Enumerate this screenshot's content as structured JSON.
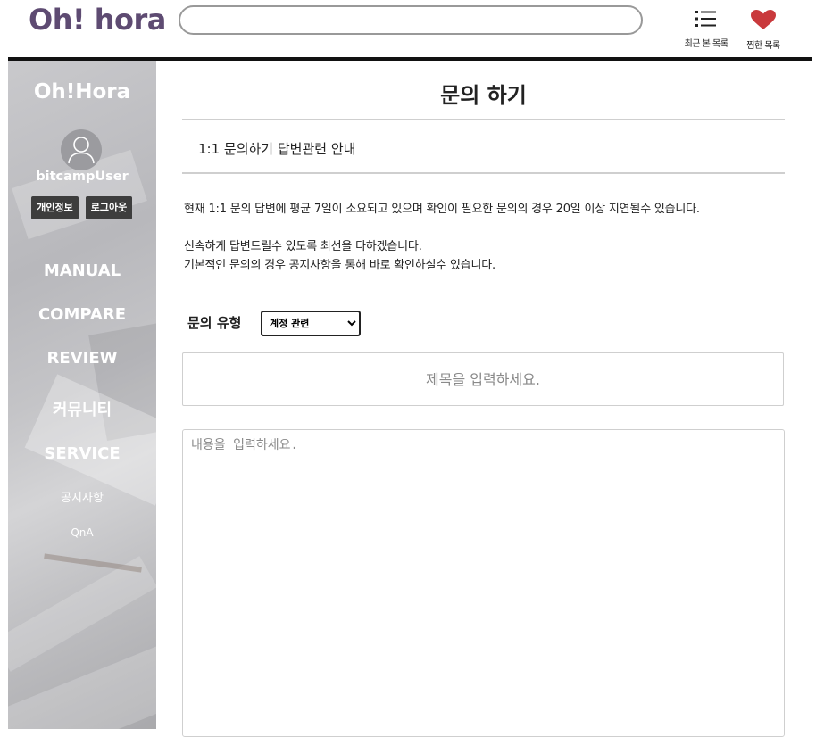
{
  "header": {
    "logo": "Oh! hora",
    "search": {
      "value": "",
      "placeholder": ""
    },
    "recent_label": "최근 본 목록",
    "wish_label": "찜한 목록",
    "accent_color": "#5e4b72",
    "heart_color": "#c9393c"
  },
  "sidebar": {
    "title": "Oh!Hora",
    "username": "bitcampUser",
    "profile_button": "개인정보",
    "logout_button": "로그아웃",
    "nav": [
      "MANUAL",
      "COMPARE",
      "REVIEW",
      "커뮤니티",
      "SERVICE"
    ],
    "sub_nav": [
      "공지사항",
      "QnA"
    ]
  },
  "main": {
    "title": "문의 하기",
    "guide_title": "1:1 문의하기 답변관련 안내",
    "notices": [
      "현재 1:1 문의 답변에 평균 7일이 소요되고 있으며 확인이 필요한 문의의 경우 20일 이상 지연될수 있습니다.",
      "신속하게 답변드릴수 있도록 최선을 다하겠습니다.",
      "기본적인 문의의 경우 공지사항을 통해 바로 확인하실수 있습니다."
    ],
    "type_label": "문의 유형",
    "type_selected": "계정 관련",
    "subject_placeholder": "제목을 입력하세요.",
    "content_placeholder": "내용을 입력하세요."
  }
}
